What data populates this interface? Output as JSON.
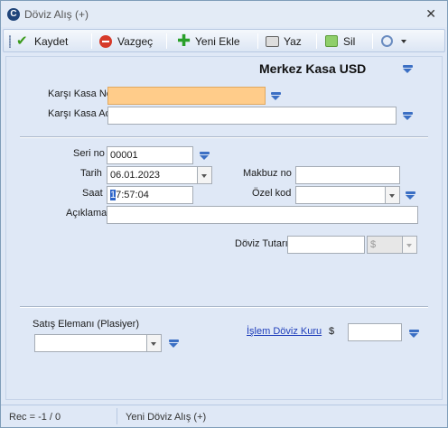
{
  "window": {
    "title": "Döviz Alış (+)",
    "close_glyph": "✕",
    "app_icon_glyph": "C"
  },
  "toolbar": {
    "save_label": "Kaydet",
    "cancel_label": "Vazgeç",
    "new_label": "Yeni Ekle",
    "print_label": "Yaz",
    "delete_label": "Sil"
  },
  "header": {
    "title": "Merkez Kasa USD"
  },
  "form": {
    "karsi_kasa_no": {
      "label": "Karşı Kasa No",
      "value": ""
    },
    "karsi_kasa_adi": {
      "label": "Karşı Kasa Adı",
      "value": ""
    },
    "seri_no": {
      "label": "Seri no",
      "value": "00001"
    },
    "tarih": {
      "label": "Tarih",
      "value": "06.01.2023"
    },
    "saat": {
      "label": "Saat",
      "value_selected": "1",
      "value_rest": "7:57:04"
    },
    "aciklama": {
      "label": "Açıklama",
      "value": ""
    },
    "makbuz_no": {
      "label": "Makbuz no",
      "value": ""
    },
    "ozel_kod": {
      "label": "Özel kod",
      "value": ""
    },
    "doviz_tutari": {
      "label": "Döviz Tutarı",
      "value": "",
      "currency": "$"
    },
    "satis_elemani": {
      "label": "Satış Elemanı (Plasiyer)",
      "value": ""
    },
    "islem_doviz_kuru": {
      "label": "İşlem Döviz Kuru",
      "currency": "$",
      "value": ""
    }
  },
  "status": {
    "record": "Rec = -1 / 0",
    "mode": "Yeni Döviz Alış (+)"
  },
  "colors": {
    "accent": "#3b6fc4",
    "highlight_field": "#ffcc8a",
    "background": "#dfe8f6"
  }
}
